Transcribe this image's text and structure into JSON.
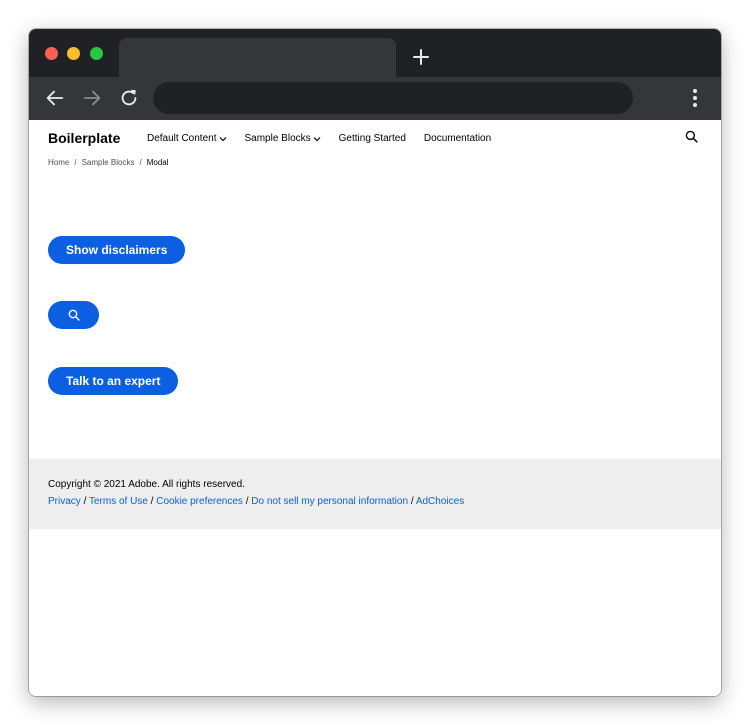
{
  "browser": {
    "tab_title": "",
    "new_tab_label": "+",
    "address": ""
  },
  "header": {
    "brand": "Boilerplate",
    "nav": [
      "Default Content",
      "Sample Blocks",
      "Getting Started",
      "Documentation"
    ]
  },
  "breadcrumb": {
    "items": [
      "Home",
      "Sample Blocks",
      "Modal"
    ],
    "separator": "/"
  },
  "main": {
    "disclaimers_button": "Show disclaimers",
    "search_button_icon": "search-icon",
    "expert_button": "Talk to an expert"
  },
  "footer": {
    "copyright": "Copyright © 2021 Adobe. All rights reserved.",
    "links": [
      "Privacy",
      "Terms of Use",
      "Cookie preferences",
      "Do not sell my personal information",
      "AdChoices"
    ],
    "separator": "/"
  },
  "colors": {
    "accent": "#0b5fe0",
    "footer_bg": "#eeeeee",
    "chrome_dark": "#202124",
    "chrome_toolbar": "#35363a"
  }
}
